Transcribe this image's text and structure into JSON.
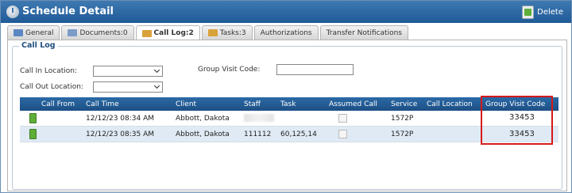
{
  "window": {
    "title": "Schedule Detail",
    "delete_label": "Delete"
  },
  "tabs": [
    {
      "label": "General"
    },
    {
      "label": "Documents:0"
    },
    {
      "label": "Call Log:2"
    },
    {
      "label": "Tasks:3"
    },
    {
      "label": "Authorizations"
    },
    {
      "label": "Transfer Notifications"
    }
  ],
  "call_log": {
    "legend": "Call Log",
    "call_in_location_label": "Call In Location:",
    "call_out_location_label": "Call Out Location:",
    "group_visit_code_label": "Group Visit Code:",
    "group_visit_code_value": ""
  },
  "grid": {
    "headers": [
      "Call From",
      "Call Time",
      "Client",
      "Staff",
      "Task",
      "Assumed Call",
      "Service",
      "Call Location",
      "Group Visit Code"
    ],
    "rows": [
      {
        "call_time": "12/12/23 08:34 AM",
        "client": "Abbott, Dakota",
        "staff": "",
        "task": "",
        "service": "1572P",
        "call_location": "",
        "group_visit_code": "33453"
      },
      {
        "call_time": "12/12/23 08:35 AM",
        "client": "Abbott, Dakota",
        "staff": "111112",
        "task": "60,125,14",
        "service": "1572P",
        "call_location": "",
        "group_visit_code": "33453"
      }
    ]
  },
  "colors": {
    "titlebar": "#2d6aa5",
    "grid_header": "#25609a",
    "highlight": "#d61a1a",
    "row_alt": "#dfeaf4"
  },
  "icons": {
    "title": "clock-icon",
    "delete": "trash-icon",
    "call": "phone-icon"
  }
}
